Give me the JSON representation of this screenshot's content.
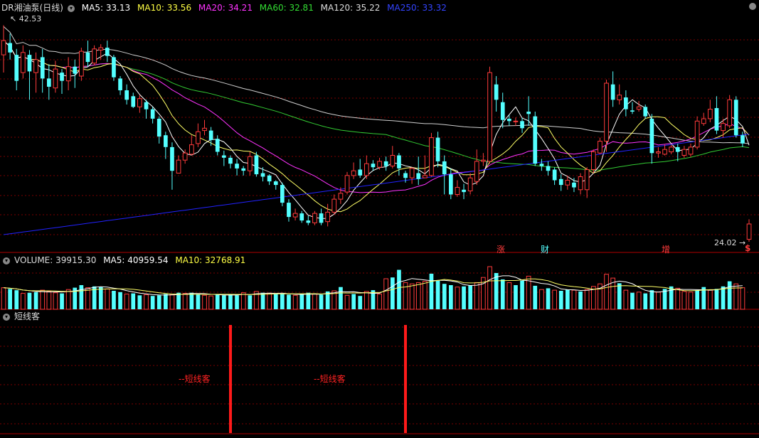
{
  "colors": {
    "up": "#ff3b3b",
    "down": "#54ffff",
    "ma5": "#ffffff",
    "ma10": "#ffff66",
    "ma20": "#ff33ff",
    "ma60": "#33cc33",
    "ma120": "#cfcfcf",
    "ma250": "#2222ff",
    "grid": "#7a0000",
    "signal": "#ff1a1a"
  },
  "price_header": {
    "title": "DR湘油泵(日线)",
    "ma5": "MA5: 33.13",
    "ma10": "MA10: 33.56",
    "ma20": "MA20: 34.21",
    "ma60": "MA60: 32.81",
    "ma120": "MA120: 35.22",
    "ma250": "MA250: 33.32",
    "high_label": "42.53",
    "low_label": "24.02"
  },
  "volume_header": {
    "title": "VOLUME: 39915.30",
    "ma5": "MA5: 40959.54",
    "ma10": "MA10: 32768.91"
  },
  "indicator_header": {
    "title": "短线客"
  },
  "event_labels": {
    "e1": "涨",
    "e2": "财",
    "e3": "增",
    "e4": "$"
  },
  "signal_labels": {
    "s1": "--短线客",
    "s2": "--短线客"
  },
  "chart_data": {
    "type": "candlestick",
    "ylim": [
      24.02,
      42.53
    ],
    "candles": [
      [
        40.0,
        41.2,
        42.5,
        38.5
      ],
      [
        41.0,
        40.2,
        41.8,
        39.6
      ],
      [
        40.0,
        37.8,
        40.5,
        37.0
      ],
      [
        38.5,
        40.2,
        40.8,
        38.0
      ],
      [
        40.0,
        38.6,
        40.4,
        36.2
      ],
      [
        38.5,
        39.6,
        40.2,
        36.8
      ],
      [
        39.8,
        38.0,
        40.5,
        36.8
      ],
      [
        38.0,
        37.3,
        39.2,
        36.2
      ],
      [
        37.2,
        38.8,
        39.5,
        36.8
      ],
      [
        38.5,
        37.8,
        38.8,
        36.7
      ],
      [
        37.8,
        39.0,
        39.8,
        37.0
      ],
      [
        39.0,
        38.4,
        39.6,
        37.2
      ],
      [
        38.2,
        40.3,
        40.6,
        37.8
      ],
      [
        40.2,
        39.4,
        41.2,
        39.0
      ],
      [
        39.3,
        40.5,
        40.8,
        39.1
      ],
      [
        40.4,
        40.6,
        40.9,
        39.6
      ],
      [
        40.6,
        39.9,
        41.2,
        39.4
      ],
      [
        39.8,
        38.1,
        40.0,
        37.8
      ],
      [
        38.0,
        37.0,
        38.2,
        36.6
      ],
      [
        37.0,
        36.2,
        37.5,
        35.8
      ],
      [
        36.5,
        35.6,
        36.8,
        35.5
      ],
      [
        35.6,
        36.3,
        36.6,
        35.1
      ],
      [
        36.0,
        35.4,
        36.2,
        34.6
      ],
      [
        35.4,
        34.6,
        35.6,
        34.2
      ],
      [
        34.6,
        33.1,
        34.8,
        32.5
      ],
      [
        33.2,
        32.2,
        33.5,
        31.2
      ],
      [
        32.2,
        30.2,
        32.6,
        28.6
      ],
      [
        30.0,
        31.1,
        31.5,
        30.0
      ],
      [
        31.1,
        31.7,
        32.0,
        30.8
      ],
      [
        31.6,
        32.4,
        33.2,
        31.5
      ],
      [
        32.5,
        33.5,
        34.2,
        32.2
      ],
      [
        33.6,
        33.8,
        34.5,
        33.2
      ],
      [
        33.6,
        32.8,
        33.9,
        32.3
      ],
      [
        32.9,
        31.8,
        33.2,
        31.5
      ],
      [
        31.5,
        31.3,
        31.9,
        30.6
      ],
      [
        31.3,
        30.8,
        31.5,
        30.4
      ],
      [
        30.8,
        30.4,
        31.2,
        29.8
      ],
      [
        30.4,
        30.2,
        30.6,
        29.8
      ],
      [
        30.2,
        31.4,
        31.8,
        29.8
      ],
      [
        31.5,
        29.9,
        31.8,
        29.7
      ],
      [
        30.0,
        29.7,
        30.5,
        29.3
      ],
      [
        29.8,
        29.3,
        29.9,
        29.0
      ],
      [
        29.3,
        29.0,
        29.4,
        28.6
      ],
      [
        29.0,
        27.5,
        29.2,
        27.2
      ],
      [
        27.5,
        26.3,
        27.8,
        25.9
      ],
      [
        26.3,
        26.6,
        27.0,
        26.0
      ],
      [
        26.6,
        26.0,
        26.8,
        25.8
      ],
      [
        26.0,
        25.8,
        26.4,
        25.6
      ],
      [
        25.8,
        26.6,
        26.8,
        25.6
      ],
      [
        26.6,
        25.8,
        27.0,
        25.6
      ],
      [
        25.9,
        26.7,
        27.4,
        25.5
      ],
      [
        26.7,
        27.8,
        28.2,
        26.5
      ],
      [
        27.8,
        28.3,
        28.8,
        27.4
      ],
      [
        28.4,
        29.8,
        30.1,
        28.2
      ],
      [
        29.8,
        30.2,
        30.9,
        29.5
      ],
      [
        30.3,
        29.8,
        31.2,
        29.6
      ],
      [
        29.8,
        30.8,
        31.5,
        29.5
      ],
      [
        30.8,
        30.5,
        31.1,
        30.2
      ],
      [
        30.5,
        31.0,
        31.3,
        30.3
      ],
      [
        31.0,
        30.6,
        31.4,
        30.2
      ],
      [
        30.6,
        31.5,
        32.3,
        30.4
      ],
      [
        31.5,
        30.4,
        31.7,
        29.8
      ],
      [
        30.0,
        29.6,
        30.2,
        29.2
      ],
      [
        29.6,
        30.4,
        30.5,
        29.1
      ],
      [
        30.0,
        29.5,
        31.4,
        29.0
      ],
      [
        29.6,
        29.8,
        31.5,
        29.6
      ],
      [
        29.8,
        33.0,
        33.4,
        29.7
      ],
      [
        33.0,
        31.0,
        33.5,
        30.5
      ],
      [
        31.0,
        29.9,
        31.5,
        28.2
      ],
      [
        29.9,
        28.2,
        30.4,
        27.8
      ],
      [
        28.2,
        28.8,
        29.4,
        28.0
      ],
      [
        28.6,
        28.4,
        29.1,
        27.8
      ],
      [
        28.5,
        29.6,
        30.0,
        28.2
      ],
      [
        29.3,
        31.0,
        32.0,
        29.0
      ],
      [
        31.0,
        31.1,
        31.7,
        30.6
      ],
      [
        31.0,
        38.5,
        39.0,
        30.8
      ],
      [
        37.5,
        36.2,
        38.2,
        35.2
      ],
      [
        36.0,
        34.5,
        36.8,
        33.8
      ],
      [
        34.6,
        34.4,
        34.9,
        34.0
      ],
      [
        34.4,
        34.4,
        34.7,
        34.0
      ],
      [
        34.4,
        33.8,
        34.7,
        33.4
      ],
      [
        35.2,
        35.0,
        36.5,
        34.0
      ],
      [
        34.8,
        30.8,
        35.2,
        30.6
      ],
      [
        30.8,
        30.6,
        31.2,
        30.2
      ],
      [
        30.6,
        30.2,
        31.0,
        29.8
      ],
      [
        30.3,
        29.4,
        30.5,
        29.0
      ],
      [
        29.5,
        29.0,
        29.9,
        28.5
      ],
      [
        29.0,
        29.4,
        29.8,
        28.6
      ],
      [
        29.2,
        28.8,
        29.6,
        28.4
      ],
      [
        28.6,
        29.7,
        30.0,
        28.2
      ],
      [
        28.6,
        30.3,
        30.5,
        27.9
      ],
      [
        30.3,
        31.8,
        32.0,
        30.0
      ],
      [
        31.7,
        32.7,
        33.0,
        31.6
      ],
      [
        32.7,
        37.6,
        37.9,
        31.8
      ],
      [
        37.5,
        36.2,
        38.6,
        35.6
      ],
      [
        36.2,
        36.6,
        37.5,
        35.8
      ],
      [
        36.4,
        35.4,
        37.0,
        34.8
      ],
      [
        35.3,
        35.2,
        36.0,
        35.0
      ],
      [
        35.4,
        35.6,
        36.1,
        35.2
      ],
      [
        35.6,
        34.8,
        35.8,
        34.6
      ],
      [
        34.6,
        31.7,
        35.0,
        30.8
      ],
      [
        31.7,
        31.8,
        32.2,
        31.3
      ],
      [
        31.6,
        32.0,
        32.4,
        31.5
      ],
      [
        31.8,
        32.2,
        32.4,
        31.6
      ],
      [
        32.2,
        31.8,
        32.5,
        31.0
      ],
      [
        31.5,
        32.0,
        32.3,
        31.3
      ],
      [
        31.6,
        32.2,
        32.5,
        31.4
      ],
      [
        32.2,
        34.4,
        34.8,
        32.0
      ],
      [
        34.2,
        34.6,
        35.1,
        34.0
      ],
      [
        34.6,
        35.4,
        36.2,
        34.3
      ],
      [
        35.5,
        33.6,
        36.5,
        33.3
      ],
      [
        33.6,
        34.2,
        34.6,
        33.0
      ],
      [
        34.0,
        36.2,
        36.6,
        33.8
      ],
      [
        36.2,
        33.2,
        36.5,
        33.0
      ],
      [
        33.2,
        32.5,
        33.5,
        32.2
      ],
      [
        24.4,
        25.7,
        26.1,
        24.2
      ]
    ],
    "volume": [
      [
        34000,
        1
      ],
      [
        32000,
        0
      ],
      [
        30000,
        0
      ],
      [
        25000,
        1
      ],
      [
        26000,
        0
      ],
      [
        27000,
        0
      ],
      [
        30000,
        1
      ],
      [
        28000,
        1
      ],
      [
        26000,
        1
      ],
      [
        25000,
        0
      ],
      [
        31000,
        1
      ],
      [
        34000,
        0
      ],
      [
        38000,
        0
      ],
      [
        34000,
        1
      ],
      [
        36000,
        0
      ],
      [
        35000,
        0
      ],
      [
        32000,
        1
      ],
      [
        29000,
        0
      ],
      [
        27000,
        0
      ],
      [
        24000,
        1
      ],
      [
        25000,
        0
      ],
      [
        22000,
        0
      ],
      [
        23000,
        1
      ],
      [
        21000,
        0
      ],
      [
        22000,
        0
      ],
      [
        24000,
        0
      ],
      [
        23000,
        1
      ],
      [
        26000,
        0
      ],
      [
        25000,
        1
      ],
      [
        26000,
        0
      ],
      [
        24000,
        0
      ],
      [
        22000,
        1
      ],
      [
        21000,
        1
      ],
      [
        23000,
        0
      ],
      [
        22000,
        0
      ],
      [
        24000,
        0
      ],
      [
        22000,
        0
      ],
      [
        26000,
        1
      ],
      [
        22000,
        0
      ],
      [
        28000,
        1
      ],
      [
        26000,
        0
      ],
      [
        25000,
        1
      ],
      [
        24000,
        0
      ],
      [
        24000,
        0
      ],
      [
        23000,
        0
      ],
      [
        22000,
        1
      ],
      [
        24000,
        0
      ],
      [
        26000,
        0
      ],
      [
        24000,
        1
      ],
      [
        23000,
        0
      ],
      [
        28000,
        0
      ],
      [
        29000,
        1
      ],
      [
        35000,
        0
      ],
      [
        22000,
        1
      ],
      [
        24000,
        0
      ],
      [
        21000,
        0
      ],
      [
        28000,
        1
      ],
      [
        30000,
        0
      ],
      [
        24000,
        1
      ],
      [
        48000,
        1
      ],
      [
        50000,
        0
      ],
      [
        62000,
        0
      ],
      [
        42000,
        1
      ],
      [
        40000,
        1
      ],
      [
        42000,
        1
      ],
      [
        44000,
        1
      ],
      [
        56000,
        0
      ],
      [
        45000,
        0
      ],
      [
        40000,
        0
      ],
      [
        38000,
        0
      ],
      [
        35000,
        1
      ],
      [
        36000,
        0
      ],
      [
        38000,
        0
      ],
      [
        42000,
        1
      ],
      [
        50000,
        1
      ],
      [
        67000,
        1
      ],
      [
        57000,
        0
      ],
      [
        47000,
        0
      ],
      [
        42000,
        1
      ],
      [
        38000,
        0
      ],
      [
        45000,
        0
      ],
      [
        52000,
        1
      ],
      [
        37000,
        0
      ],
      [
        31000,
        1
      ],
      [
        33000,
        0
      ],
      [
        30000,
        1
      ],
      [
        29000,
        0
      ],
      [
        31000,
        0
      ],
      [
        30000,
        1
      ],
      [
        28000,
        0
      ],
      [
        31000,
        1
      ],
      [
        36000,
        1
      ],
      [
        40000,
        1
      ],
      [
        55000,
        1
      ],
      [
        49000,
        1
      ],
      [
        41000,
        0
      ],
      [
        30000,
        1
      ],
      [
        26000,
        0
      ],
      [
        27000,
        1
      ],
      [
        25000,
        0
      ],
      [
        30000,
        0
      ],
      [
        27000,
        1
      ],
      [
        32000,
        0
      ],
      [
        36000,
        0
      ],
      [
        33000,
        1
      ],
      [
        28000,
        1
      ],
      [
        27000,
        1
      ],
      [
        30000,
        0
      ],
      [
        35000,
        0
      ],
      [
        30000,
        1
      ],
      [
        32000,
        0
      ],
      [
        36000,
        0
      ],
      [
        44000,
        0
      ],
      [
        40000,
        1
      ],
      [
        34000,
        1
      ]
    ],
    "signals": [
      35,
      62
    ]
  }
}
